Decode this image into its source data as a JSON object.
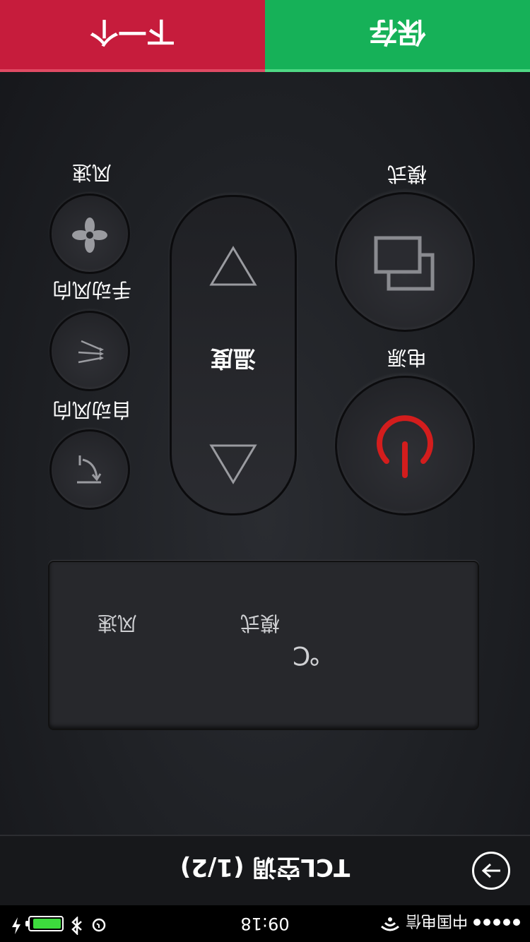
{
  "status_bar": {
    "carrier": "中国电信",
    "time": "09:18",
    "battery_level": 0.85
  },
  "header": {
    "title": "TCL空调 (1/2)",
    "back_icon": "arrow-right-circle-icon"
  },
  "display": {
    "temperature": "℃",
    "mode_label": "模式",
    "fan_speed_label": "风速"
  },
  "controls": {
    "mode_label": "模式",
    "power_label": "电源",
    "temperature_label": "温度",
    "fan_speed_label": "风速",
    "manual_swing_label": "手动风向",
    "auto_swing_label": "自动风向"
  },
  "actions": {
    "next_label": "下一个",
    "save_label": "保存"
  },
  "colors": {
    "save": "#16b158",
    "next": "#c61c3c",
    "power_icon": "#d31d1d"
  }
}
